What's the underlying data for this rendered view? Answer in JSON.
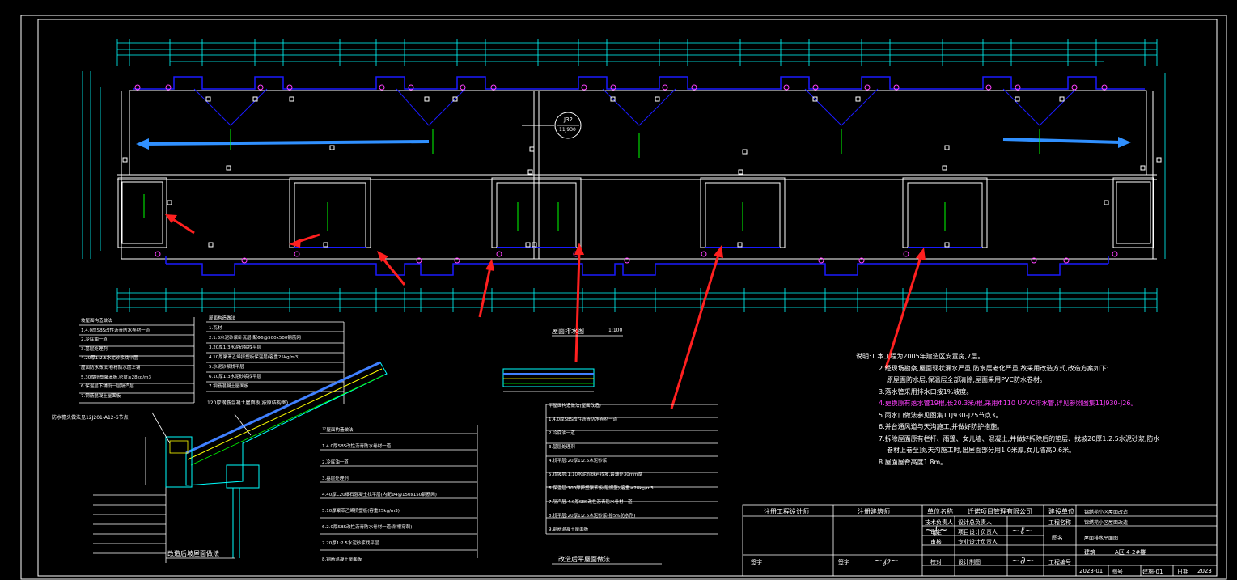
{
  "drawing": {
    "plan_label": "屋面排水图",
    "plan_scale": "1:100",
    "bottom_caption": "改造后平屋面做法",
    "left_caption": "改造后坡屋面做法",
    "detail_ref": "J32",
    "detail_ref_sub": "11J930",
    "eave_ref": "防水檐头做法见12J201-A12-6节点",
    "slope_layer_note": "120厚钢筋混凝土屋面板(按原结构图)"
  },
  "notes": [
    "说明:1.本工程为2005年建造区安置房,7层。",
    "2.经现场勘察,屋面现状漏水严重,防水层老化严重,故采用改造方式,改造方案如下:",
    "原屋面防水层,保温层全部清除,屋面采用PVC防水卷材。",
    "3.落水管采用排水口按1%坡度。",
    "4.更换原有落水管19根,长20.3米/根,采用Φ110 UPVC排水管,详见参照图集11J930-J26。",
    "5.雨水口做法参见图集11J930-J25节点3。",
    "6.并台通风道与天沟施工,并做好防护措施。",
    "7.拆除屋面原有栏杆、雨篷、女儿墙、混凝土,并做好拆除后的垫层、找坡20厚1:2.5水泥砂浆,防水",
    "卷材上卷至顶,天沟施工时,出屋面部分用1.0米厚,女儿墙高0.6米。",
    "8.屋面屋脊高度1.8m。"
  ],
  "legend_top_left": {
    "title": "坡屋面构造做法",
    "items": [
      "1.4.0厚SBS改性沥青防水卷材一道",
      "2.冷底油一道",
      "3.基层处理剂",
      "4.20厚1:2.5水泥砂浆找平层",
      "屋面防水做法:卷材防水层上铺",
      "5.30厚挤塑聚苯板,密度≥28kg/m3",
      "6.保温层下铺设一层隔汽层",
      "7.钢筋混凝土屋面板"
    ]
  },
  "legend_mid": {
    "title": "屋面构造做法",
    "items": [
      "1.瓦材",
      "2.1:3水泥砂浆卧瓦层,配Φ6@500x500钢筋网",
      "3.20厚1:3水泥砂浆找平层",
      "4.10厚聚苯乙烯挤塑板保温层(容重25kg/m3)",
      "5.水泥砂浆找平层",
      "6.10厚1:3水泥砂浆找平层",
      "7.钢筋混凝土屋面板"
    ]
  },
  "legend_flat": {
    "title": "平屋面构造做法",
    "items": [
      "1.4.0厚SBS改性沥青防水卷材一道",
      "2.冷底油一道",
      "3.基层处理剂",
      "4.40厚C20细石混凝土找平层(内配Φ4@150x150钢筋网)",
      "5.10厚聚苯乙烯挤塑板(容重25kg/m3)",
      "6.2.0厚SBS改性沥青防水卷材一道(耐根穿刺)",
      "7.20厚1:2.5水泥砂浆找平层",
      "8.钢筋混凝土屋面板"
    ]
  },
  "legend_right": {
    "title": "平屋面构造做法(屋面改造)",
    "items": [
      "1.4.0厚SBS改性沥青防水卷材一道",
      "2.冷底油一道",
      "3.基层处理剂",
      "4.找平层:20厚1:2.5水泥砂浆",
      "5.找坡层:1:10水泥珍珠岩找坡,最薄处30mm厚",
      "6.保温层:100厚挤塑聚苯板(阻燃型),容重≥28kg/m3",
      "7.隔汽层:4.0厚SBS改性沥青防水卷材一道",
      "8.找平层:20厚1:2.5水泥砂浆(掺5%防水剂)",
      "9.钢筋混凝土屋面板"
    ]
  },
  "title_block": {
    "head1": "注册工程设计师",
    "head2": "注册建筑师",
    "col_unit": "单位名称",
    "company": "迁诺项目管理有限公司",
    "client_label": "建设单位",
    "client": "锦绣苑小区屋面改造",
    "row_tech": "技术负责人",
    "row_design_lead": "设计总负责人",
    "project_label": "工程名称",
    "project": "锦绣苑小区屋面改造",
    "row_approve": "审定",
    "row_proj_lead": "项目设计负责人",
    "drawing_name_label": "图名",
    "drawing_name": "屋面排水平面图",
    "row_review": "审核",
    "row_pro_lead": "专业设计负责人",
    "dept": "建筑",
    "scope": "A区 4-2#楼",
    "sign_label": "签字",
    "sign_label2": "签字",
    "row_check": "校对",
    "row_draw": "设计制图",
    "row_no": "工程编号",
    "proj_no": "2023-01",
    "fig_label": "图号",
    "fig_no": "建施-01",
    "date_label": "日期",
    "date": "2023"
  },
  "colors": {
    "frame": "#ffffff",
    "wall": "#ffffff",
    "drain": "#0000ff",
    "dims": "#00ffff",
    "arrow_green": "#00ff00",
    "callout_red": "#ff2020",
    "blue_arrow": "#3090ff",
    "pink": "#ff40ff",
    "yellow": "#ffff00"
  }
}
